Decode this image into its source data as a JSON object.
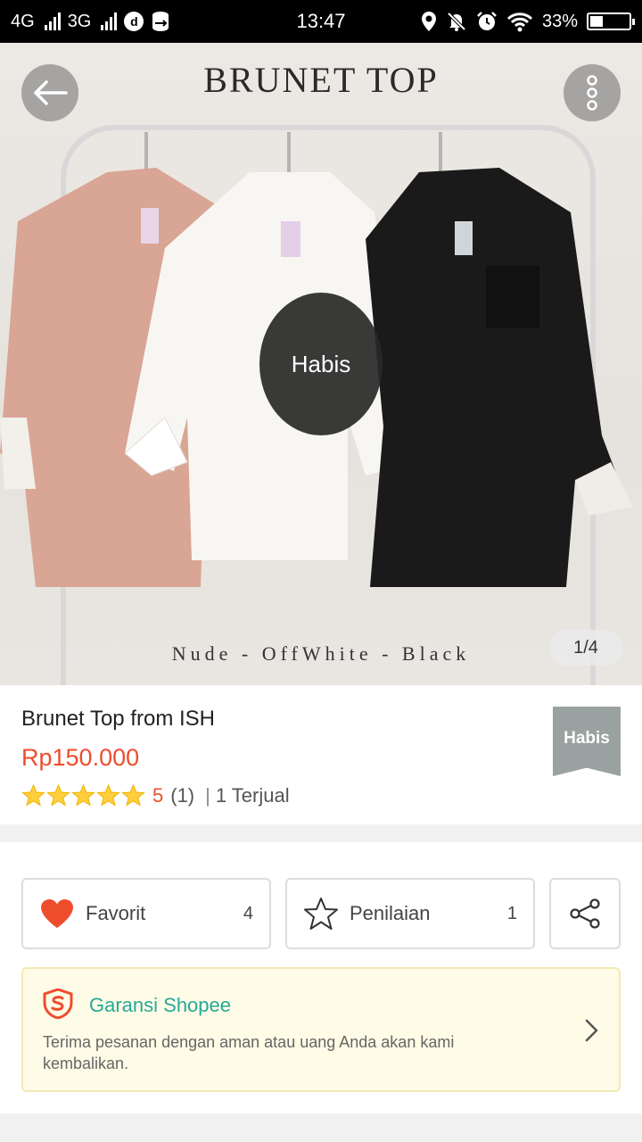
{
  "status_bar": {
    "network1": "4G",
    "network2": "3G",
    "data_icon": "d",
    "time": "13:47",
    "battery_percent": "33%",
    "battery_level": 0.33,
    "icons": [
      "signal-icon",
      "data-saver-icon",
      "location-icon",
      "mute-icon",
      "alarm-icon",
      "wifi-icon",
      "battery-icon"
    ]
  },
  "product_image": {
    "title": "BRUNET TOP",
    "colors_caption": "Nude - OffWhite - Black",
    "status_overlay": "Habis",
    "pager": "1/4",
    "shirt_colors": [
      "#d9a594",
      "#f8f6f3",
      "#1a1a1a"
    ]
  },
  "product": {
    "name": "Brunet Top from ISH",
    "price": "Rp150.000",
    "rating_score": "5",
    "rating_count": "(1)",
    "sold_separator": "|",
    "sold": "1 Terjual",
    "stars": 5,
    "stock_badge": "Habis"
  },
  "actions": {
    "favorite_label": "Favorit",
    "favorite_count": "4",
    "rating_label": "Penilaian",
    "rating_count": "1"
  },
  "guarantee": {
    "title": "Garansi Shopee",
    "description": "Terima pesanan dengan aman atau uang Anda akan kami kembalikan."
  },
  "colors": {
    "accent": "#ee4d2d",
    "guarantee_green": "#26aa99",
    "star": "#ffce3d",
    "heart": "#ee4d2d"
  }
}
